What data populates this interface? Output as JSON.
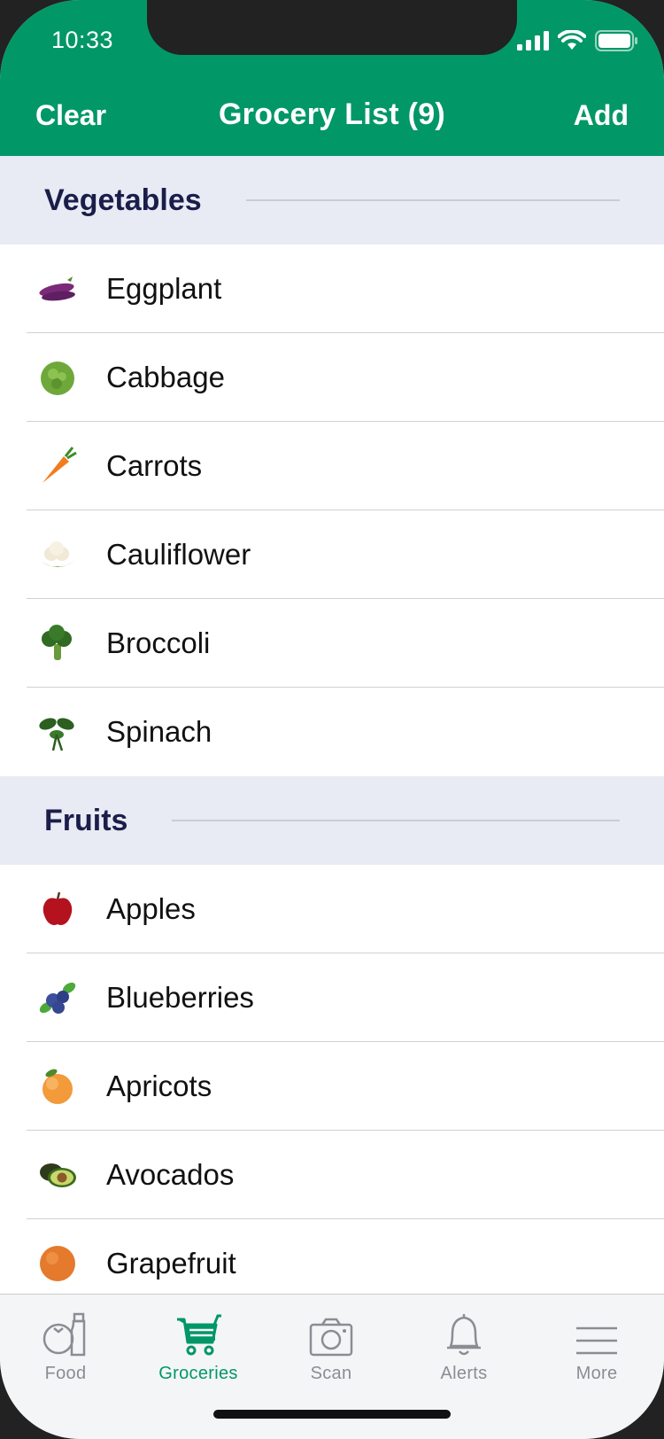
{
  "status": {
    "time": "10:33"
  },
  "nav": {
    "left": "Clear",
    "title": "Grocery List (9)",
    "right": "Add"
  },
  "sections": [
    {
      "title": "Vegetables",
      "items": [
        {
          "label": "Eggplant",
          "icon": "eggplant-icon"
        },
        {
          "label": "Cabbage",
          "icon": "cabbage-icon"
        },
        {
          "label": "Carrots",
          "icon": "carrot-icon"
        },
        {
          "label": "Cauliflower",
          "icon": "cauliflower-icon"
        },
        {
          "label": "Broccoli",
          "icon": "broccoli-icon"
        },
        {
          "label": "Spinach",
          "icon": "spinach-icon"
        }
      ]
    },
    {
      "title": "Fruits",
      "items": [
        {
          "label": "Apples",
          "icon": "apple-icon"
        },
        {
          "label": "Blueberries",
          "icon": "blueberries-icon"
        },
        {
          "label": "Apricots",
          "icon": "apricot-icon"
        },
        {
          "label": "Avocados",
          "icon": "avocado-icon"
        },
        {
          "label": "Grapefruit",
          "icon": "grapefruit-icon"
        }
      ]
    }
  ],
  "tabs": [
    {
      "label": "Food",
      "icon": "food-icon",
      "active": false
    },
    {
      "label": "Groceries",
      "icon": "cart-icon",
      "active": true
    },
    {
      "label": "Scan",
      "icon": "camera-icon",
      "active": false
    },
    {
      "label": "Alerts",
      "icon": "bell-icon",
      "active": false
    },
    {
      "label": "More",
      "icon": "menu-icon",
      "active": false
    }
  ],
  "colors": {
    "brand": "#029766",
    "section_bg": "#e8ebf3",
    "section_title": "#1b1d4a",
    "tab_inactive": "#8a8d93"
  }
}
